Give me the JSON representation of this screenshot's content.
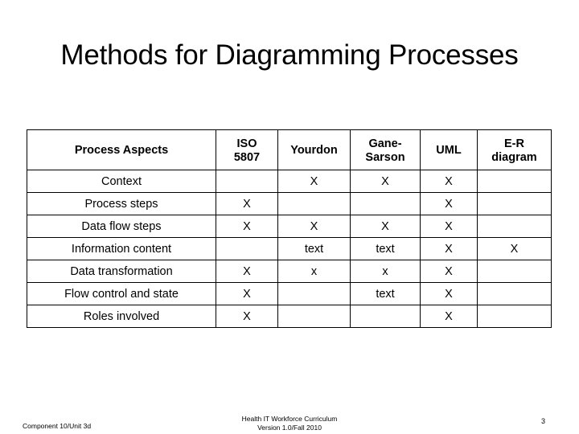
{
  "slide": {
    "title": "Methods for Diagramming Processes",
    "page_number": "3"
  },
  "colors": {
    "text": "#000000",
    "gane_sarson_accent": "#333366",
    "iso_header_gray": "#6b6b6b",
    "border": "#000000",
    "background": "#ffffff"
  },
  "table": {
    "columns": [
      {
        "key": "aspect",
        "label": "Process Aspects"
      },
      {
        "key": "iso",
        "label_line1": "ISO",
        "label_line2": "5807"
      },
      {
        "key": "yourdon",
        "label": "Yourdon"
      },
      {
        "key": "gane",
        "label_line1": "Gane-",
        "label_line2": "Sarson"
      },
      {
        "key": "uml",
        "label": "UML"
      },
      {
        "key": "er",
        "label_line1": "E-R",
        "label_line2": "diagram"
      }
    ],
    "rows": [
      {
        "label": "Context",
        "iso": "",
        "yourdon": "X",
        "gane": "X",
        "uml": "X",
        "er": ""
      },
      {
        "label": "Process steps",
        "iso": "X",
        "yourdon": "",
        "gane": "",
        "uml": "X",
        "er": ""
      },
      {
        "label": "Data flow steps",
        "iso": "X",
        "yourdon": "X",
        "gane": "X",
        "uml": "X",
        "er": ""
      },
      {
        "label": "Information content",
        "iso": "",
        "yourdon": "text",
        "gane": "text",
        "uml": "X",
        "er": "X"
      },
      {
        "label": "Data transformation",
        "iso": "X",
        "yourdon": "x",
        "gane": "x",
        "uml": "X",
        "er": ""
      },
      {
        "label": "Flow control and state",
        "iso": "X",
        "yourdon": "",
        "gane": "text",
        "uml": "X",
        "er": ""
      },
      {
        "label": "Roles involved",
        "iso": "X",
        "yourdon": "",
        "gane": "",
        "uml": "X",
        "er": ""
      }
    ]
  },
  "footer": {
    "left": "Component 10/Unit 3d",
    "center_line1": "Health IT Workforce Curriculum",
    "center_line2": "Version 1.0/Fall 2010"
  }
}
